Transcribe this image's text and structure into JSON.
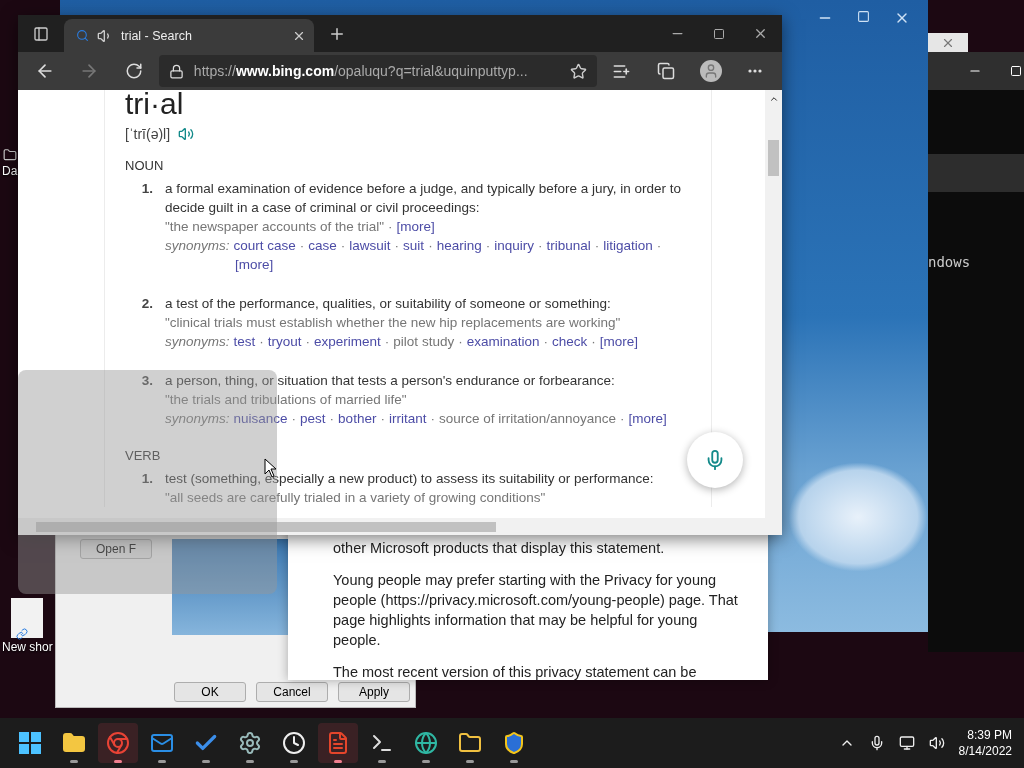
{
  "desktop": {
    "icons": [
      {
        "label": "Da",
        "kind": "folder"
      },
      {
        "label": "New shor",
        "kind": "shortcut"
      }
    ]
  },
  "terminal": {
    "text": "ndows"
  },
  "browser": {
    "tab_title": "trial - Search",
    "url_prefix": "https://",
    "url_domain": "www.bing.com",
    "url_rest": "/opaluqu?q=trial&uquinputtyp...",
    "dictionary": {
      "headword": "tri·al",
      "pronunciation": "[ˈtrī(ə)l]",
      "separator": "·",
      "sections": [
        {
          "part": "NOUN",
          "senses": [
            {
              "number": "1.",
              "definition": "a formal examination of evidence before a judge, and typically before a jury, in order to decide guilt in a case of criminal or civil proceedings:",
              "example": "\"the newspaper accounts of the trial\"",
              "example_more": "[more]",
              "synonyms_label": "synonyms:",
              "synonyms": [
                {
                  "text": "court case",
                  "kind": "link"
                },
                {
                  "text": "case",
                  "kind": "link"
                },
                {
                  "text": "lawsuit",
                  "kind": "link"
                },
                {
                  "text": "suit",
                  "kind": "link"
                },
                {
                  "text": "hearing",
                  "kind": "link"
                },
                {
                  "text": "inquiry",
                  "kind": "link"
                },
                {
                  "text": "tribunal",
                  "kind": "link"
                },
                {
                  "text": "litigation",
                  "kind": "link"
                },
                {
                  "text": "[more]",
                  "kind": "more"
                }
              ]
            },
            {
              "number": "2.",
              "definition": "a test of the performance, qualities, or suitability of someone or something:",
              "example": "\"clinical trials must establish whether the new hip replacements are working\"",
              "synonyms_label": "synonyms:",
              "synonyms": [
                {
                  "text": "test",
                  "kind": "link"
                },
                {
                  "text": "tryout",
                  "kind": "link"
                },
                {
                  "text": "experiment",
                  "kind": "link"
                },
                {
                  "text": "pilot study",
                  "kind": "plain"
                },
                {
                  "text": "examination",
                  "kind": "link"
                },
                {
                  "text": "check",
                  "kind": "link"
                },
                {
                  "text": "[more]",
                  "kind": "more"
                }
              ]
            },
            {
              "number": "3.",
              "definition": "a person, thing, or situation that tests a person's endurance or forbearance:",
              "example": "\"the trials and tribulations of married life\"",
              "synonyms_label": "synonyms:",
              "synonyms": [
                {
                  "text": "nuisance",
                  "kind": "link"
                },
                {
                  "text": "pest",
                  "kind": "link"
                },
                {
                  "text": "bother",
                  "kind": "link"
                },
                {
                  "text": "irritant",
                  "kind": "link"
                },
                {
                  "text": "source of irritation/annoyance",
                  "kind": "plain"
                },
                {
                  "text": "[more]",
                  "kind": "more"
                }
              ]
            }
          ]
        },
        {
          "part": "VERB",
          "senses": [
            {
              "number": "1.",
              "definition": "test (something, especially a new product) to assess its suitability or performance:",
              "example": "\"all seeds are carefully trialed in a variety of growing conditions\""
            }
          ]
        }
      ]
    }
  },
  "properties_dialog": {
    "open_button": "Open F",
    "buttons": [
      "OK",
      "Cancel",
      "Apply"
    ]
  },
  "privacy_window": {
    "paragraphs": [
      "other Microsoft products that display this statement.",
      "Young people may prefer starting with the Privacy for young people (https://privacy.microsoft.com/young-people) page. That page highlights information that may be helpful for young people.",
      "The most recent version of this privacy statement can be"
    ]
  },
  "taskbar": {
    "apps": [
      {
        "kind": "start",
        "active": false
      },
      {
        "kind": "explorer",
        "active": false
      },
      {
        "kind": "chrome",
        "active": true
      },
      {
        "kind": "mail",
        "active": false
      },
      {
        "kind": "todo",
        "active": false
      },
      {
        "kind": "settings",
        "active": false
      },
      {
        "kind": "clock",
        "active": false
      },
      {
        "kind": "office",
        "active": true
      },
      {
        "kind": "terminal",
        "active": false
      },
      {
        "kind": "edge",
        "active": false
      },
      {
        "kind": "files",
        "active": false
      },
      {
        "kind": "security",
        "active": false
      }
    ],
    "time": "8:39 PM",
    "date": "8/14/2022"
  }
}
